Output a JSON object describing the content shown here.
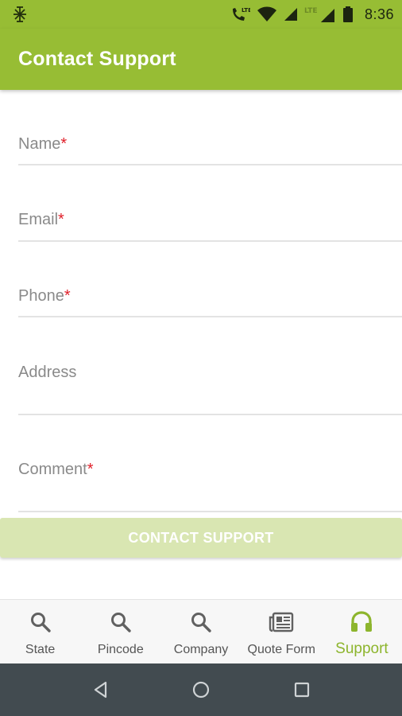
{
  "status_bar": {
    "time": "8:36",
    "icons": [
      "app-notification-icon",
      "lte-call-icon",
      "wifi-icon",
      "signal-icon",
      "lte-signal-icon",
      "battery-icon"
    ],
    "lte_label": "LTE"
  },
  "app_bar": {
    "title": "Contact Support"
  },
  "form": {
    "fields": [
      {
        "label": "Name",
        "required_mark": "*"
      },
      {
        "label": "Email",
        "required_mark": "*"
      },
      {
        "label": "Phone",
        "required_mark": "*"
      },
      {
        "label": "Address",
        "required_mark": ""
      },
      {
        "label": "Comment",
        "required_mark": "*"
      }
    ],
    "submit_label": "CONTACT SUPPORT"
  },
  "bottom_nav": {
    "items": [
      {
        "label": "State",
        "icon": "search-icon"
      },
      {
        "label": "Pincode",
        "icon": "search-icon"
      },
      {
        "label": "Company",
        "icon": "search-icon"
      },
      {
        "label": "Quote Form",
        "icon": "newspaper-icon"
      },
      {
        "label": "Support",
        "icon": "headphones-icon",
        "active": true
      }
    ]
  },
  "system_nav": {
    "buttons": [
      "back-icon",
      "home-icon",
      "recents-icon"
    ]
  },
  "colors": {
    "primary": "#97bd34",
    "accent_active": "#8db52d",
    "required": "#e0202a",
    "button_disabled": "#d9e6b2",
    "system_nav": "#424b50"
  }
}
